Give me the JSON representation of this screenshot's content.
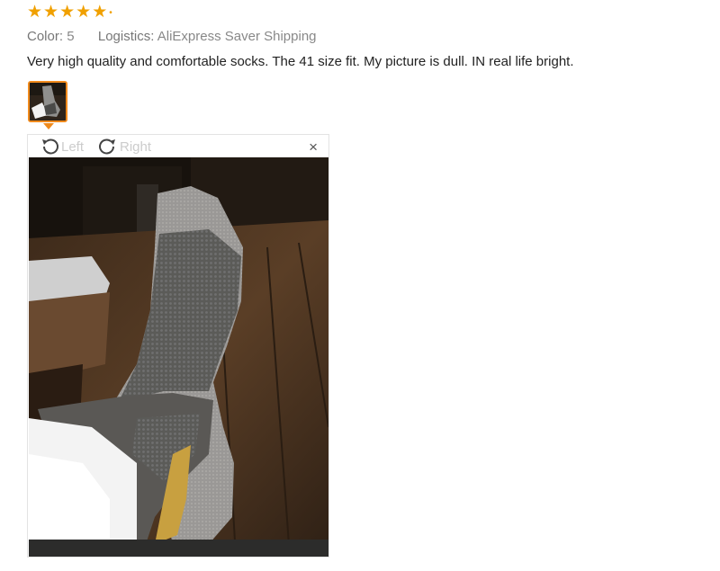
{
  "review": {
    "rating": 5,
    "stars": [
      "★",
      "★",
      "★",
      "★",
      "★"
    ],
    "color_label": "Color:",
    "color_value": "5",
    "logistics_label": "Logistics:",
    "logistics_value": "AliExpress Saver Shipping",
    "text": "Very high quality and comfortable socks. The 41 size fit. My picture is dull. IN real life bright."
  },
  "viewer": {
    "rotate_left_label": "Left",
    "rotate_right_label": "Right",
    "close_label": "×"
  },
  "colors": {
    "star": "#f0a000",
    "thumb_border": "#f08a1c",
    "muted_text": "#888888",
    "disabled_text": "#cccccc"
  },
  "icons": [
    "star-icon",
    "rotate-left-icon",
    "rotate-right-icon",
    "close-icon"
  ]
}
